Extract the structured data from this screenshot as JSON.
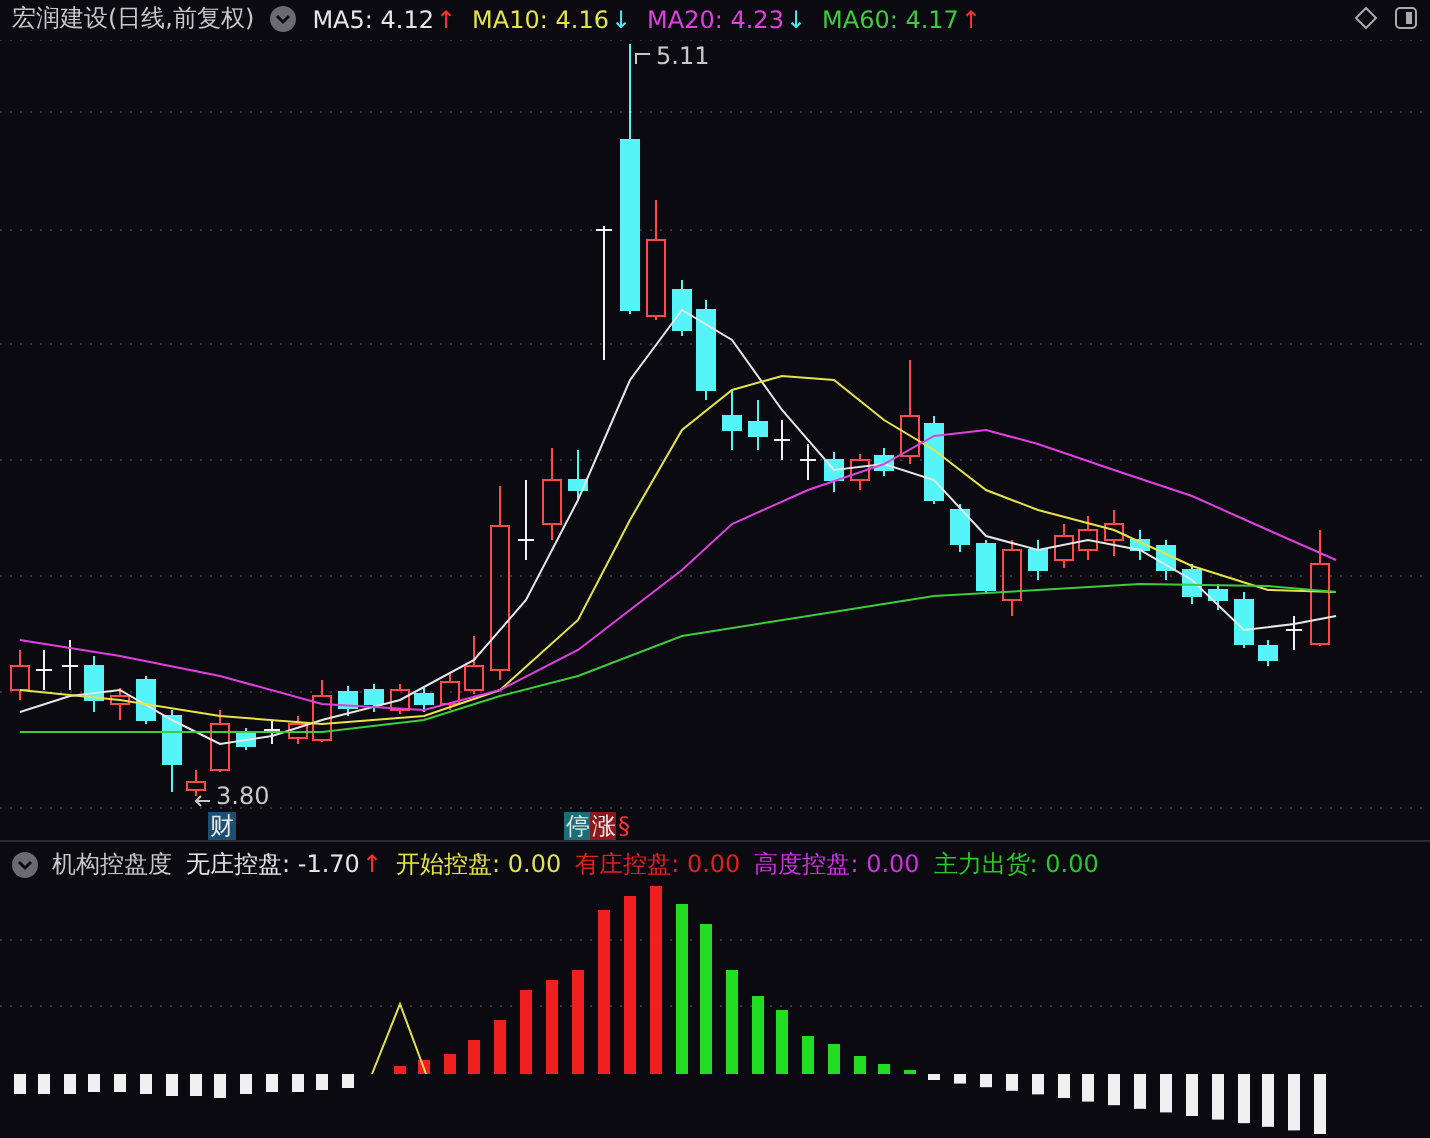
{
  "header": {
    "title": "宏润建设(日线,前复权)",
    "ma": [
      {
        "label": "MA5:",
        "value": "4.12",
        "color": "#e6e6e6",
        "arrow": {
          "text": "↑",
          "color": "#ff3030"
        }
      },
      {
        "label": "MA10:",
        "value": "4.16",
        "color": "#e6e34a",
        "arrow": {
          "text": "↓",
          "color": "#50e8f0"
        }
      },
      {
        "label": "MA20:",
        "value": "4.23",
        "color": "#e040e0",
        "arrow": {
          "text": "↓",
          "color": "#50e8f0"
        }
      },
      {
        "label": "MA60:",
        "value": "4.17",
        "color": "#3ccc3c",
        "arrow": {
          "text": "↑",
          "color": "#ff3030"
        }
      }
    ]
  },
  "price_chart": {
    "high_label": "5.11",
    "low_label": "3.80",
    "markers": [
      {
        "text": "财",
        "color": "#1d4f73"
      },
      {
        "text": "停",
        "color": "#1b6e78"
      },
      {
        "text": "涨",
        "color": "#8a1a1a"
      },
      {
        "text": "§",
        "color": "#0b0a10"
      }
    ]
  },
  "indicator": {
    "title": "机构控盘度",
    "items": [
      {
        "label": "无庄控盘:",
        "value": "-1.70",
        "color": "#e6e6e6",
        "arrow": {
          "text": "↑",
          "color": "#ff3030"
        }
      },
      {
        "label": "开始控盘:",
        "value": "0.00",
        "color": "#e6e34a"
      },
      {
        "label": "有庄控盘:",
        "value": "0.00",
        "color": "#e02020"
      },
      {
        "label": "高度控盘:",
        "value": "0.00",
        "color": "#d030e0"
      },
      {
        "label": "主力出货:",
        "value": "0.00",
        "color": "#28c828"
      }
    ]
  }
}
